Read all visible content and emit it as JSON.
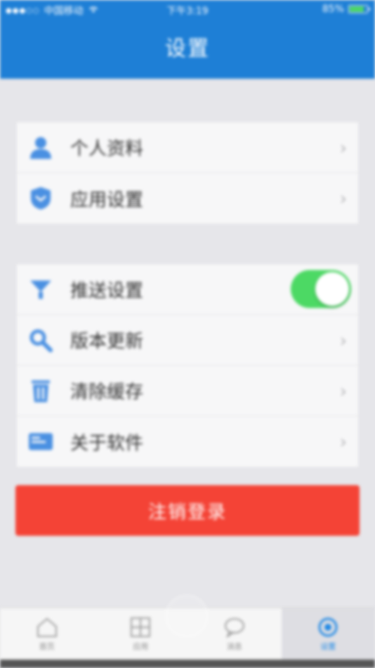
{
  "status_bar": {
    "carrier": "中国移动",
    "time": "下午3:19",
    "battery": "85%",
    "battery_level": 0.85
  },
  "nav": {
    "title": "设置"
  },
  "groups": [
    {
      "items": [
        {
          "label": "个人资料",
          "icon": "person-icon"
        },
        {
          "label": "应用设置",
          "icon": "shield-icon"
        }
      ]
    },
    {
      "items": [
        {
          "label": "推送设置",
          "icon": "push-icon",
          "toggle": true
        },
        {
          "label": "版本更新",
          "icon": "search-icon"
        },
        {
          "label": "清除缓存",
          "icon": "trash-icon"
        },
        {
          "label": "关于软件",
          "icon": "card-icon"
        }
      ]
    }
  ],
  "logout": {
    "label": "注销登录"
  },
  "tabs": [
    {
      "label": "首页",
      "icon": "home-icon"
    },
    {
      "label": "应用",
      "icon": "grid-icon"
    },
    {
      "label": "消息",
      "icon": "chat-icon"
    },
    {
      "label": "设置",
      "icon": "gear-icon",
      "active": true
    }
  ],
  "colors": {
    "accent": "#1e7fd6",
    "danger": "#f44336",
    "toggle_on": "#4cd964",
    "icon_blue": "#4a90e2"
  }
}
